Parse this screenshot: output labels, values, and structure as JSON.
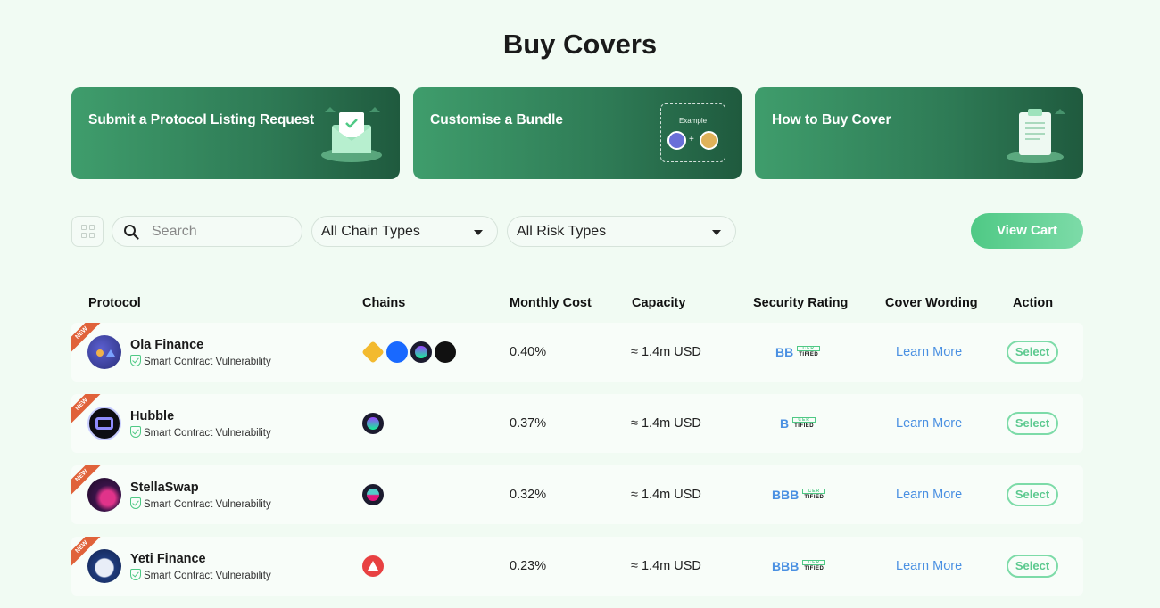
{
  "page": {
    "title": "Buy Covers"
  },
  "banners": [
    {
      "label": "Submit a Protocol Listing Request",
      "icon": "envelope-icon"
    },
    {
      "label": "Customise a Bundle",
      "example_label": "Example",
      "plus": "+"
    },
    {
      "label": "How to Buy Cover",
      "icon": "clipboard-icon"
    }
  ],
  "toolbar": {
    "search_placeholder": "Search",
    "chain_filter": "All Chain Types",
    "risk_filter": "All Risk Types",
    "view_cart": "View Cart"
  },
  "table": {
    "headers": {
      "protocol": "Protocol",
      "chains": "Chains",
      "monthly_cost": "Monthly Cost",
      "capacity": "Capacity",
      "security_rating": "Security Rating",
      "cover_wording": "Cover Wording",
      "action": "Action"
    },
    "rows": [
      {
        "badge": "NEW",
        "name": "Ola Finance",
        "risk": "Smart Contract Vulnerability",
        "chains": [
          "bnb-chain-icon",
          "fantom-icon",
          "solana-icon",
          "chain-icon"
        ],
        "cost": "0.40%",
        "capacity": "≈ 1.4m USD",
        "rating": "BB",
        "certik_top": "CER",
        "certik_bottom": "TIFIED",
        "link": "Learn More",
        "action": "Select"
      },
      {
        "badge": "NEW",
        "name": "Hubble",
        "risk": "Smart Contract Vulnerability",
        "chains": [
          "solana-icon"
        ],
        "cost": "0.37%",
        "capacity": "≈ 1.4m USD",
        "rating": "B",
        "certik_top": "CER",
        "certik_bottom": "TIFIED",
        "link": "Learn More",
        "action": "Select"
      },
      {
        "badge": "NEW",
        "name": "StellaSwap",
        "risk": "Smart Contract Vulnerability",
        "chains": [
          "moonbeam-icon"
        ],
        "cost": "0.32%",
        "capacity": "≈ 1.4m USD",
        "rating": "BBB",
        "certik_top": "CER",
        "certik_bottom": "TIFIED",
        "link": "Learn More",
        "action": "Select"
      },
      {
        "badge": "NEW",
        "name": "Yeti Finance",
        "risk": "Smart Contract Vulnerability",
        "chains": [
          "avalanche-icon"
        ],
        "cost": "0.23%",
        "capacity": "≈ 1.4m USD",
        "rating": "BBB",
        "certik_top": "CER",
        "certik_bottom": "TIFIED",
        "link": "Learn More",
        "action": "Select"
      }
    ]
  }
}
